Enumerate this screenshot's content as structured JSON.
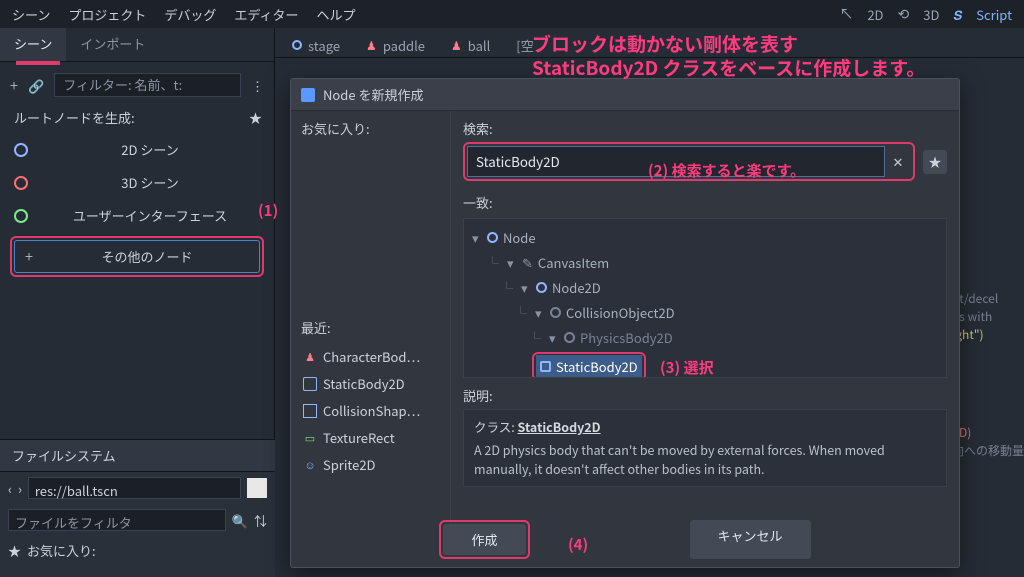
{
  "menubar": {
    "items": [
      "シーン",
      "プロジェクト",
      "デバッグ",
      "エディター",
      "ヘルプ"
    ],
    "right": {
      "view2d": "2D",
      "view3d": "3D",
      "script": "Script"
    }
  },
  "left_panel": {
    "tabs": {
      "scene": "シーン",
      "import": "インポート"
    },
    "filter_placeholder": "フィルター: 名前、t:",
    "root_label": "ルートノードを生成:",
    "scene_buttons": {
      "scene2d": "2D シーン",
      "scene3d": "3D シーン",
      "ui": "ユーザーインターフェース",
      "other": "その他のノード"
    }
  },
  "filesystem": {
    "title": "ファイルシステム",
    "path": "res://ball.tscn",
    "filter_placeholder": "ファイルをフィルタ",
    "favorites": "お気に入り:"
  },
  "open_tabs": [
    "stage",
    "paddle",
    "ball",
    "[空"
  ],
  "dialog": {
    "title": "Node を新規作成",
    "favorites_label": "お気に入り:",
    "recent_label": "最近:",
    "recent_items": [
      "CharacterBod…",
      "StaticBody2D",
      "CollisionShap…",
      "TextureRect",
      "Sprite2D"
    ],
    "search_label": "検索:",
    "search_value": "StaticBody2D",
    "match_label": "一致:",
    "tree": {
      "node": "Node",
      "canvasitem": "CanvasItem",
      "node2d": "Node2D",
      "collision": "CollisionObject2D",
      "physics": "PhysicsBody2D",
      "static": "StaticBody2D"
    },
    "desc_label": "説明:",
    "desc_class_label": "クラス:",
    "desc_class_name": "StaticBody2D",
    "desc_text": "A 2D physics body that can't be moved by external forces. When moved manually, it doesn't affect other bodies in its path.",
    "buttons": {
      "create": "作成",
      "cancel": "キャンセル"
    }
  },
  "annotations": {
    "line1": "ブロックは動かない剛体を表す",
    "line2": "StaticBody2D クラスをベースに作成します。",
    "step1": "(1)",
    "step2": "(2) 検索すると楽です。",
    "step3": "(3) 選択",
    "step4": "(4)"
  },
  "code_bg": {
    "l1": "nt/decel",
    "l2": "ns with",
    "l3": "ight\")",
    "l4": "ED)",
    "l5": "向への移動量"
  }
}
